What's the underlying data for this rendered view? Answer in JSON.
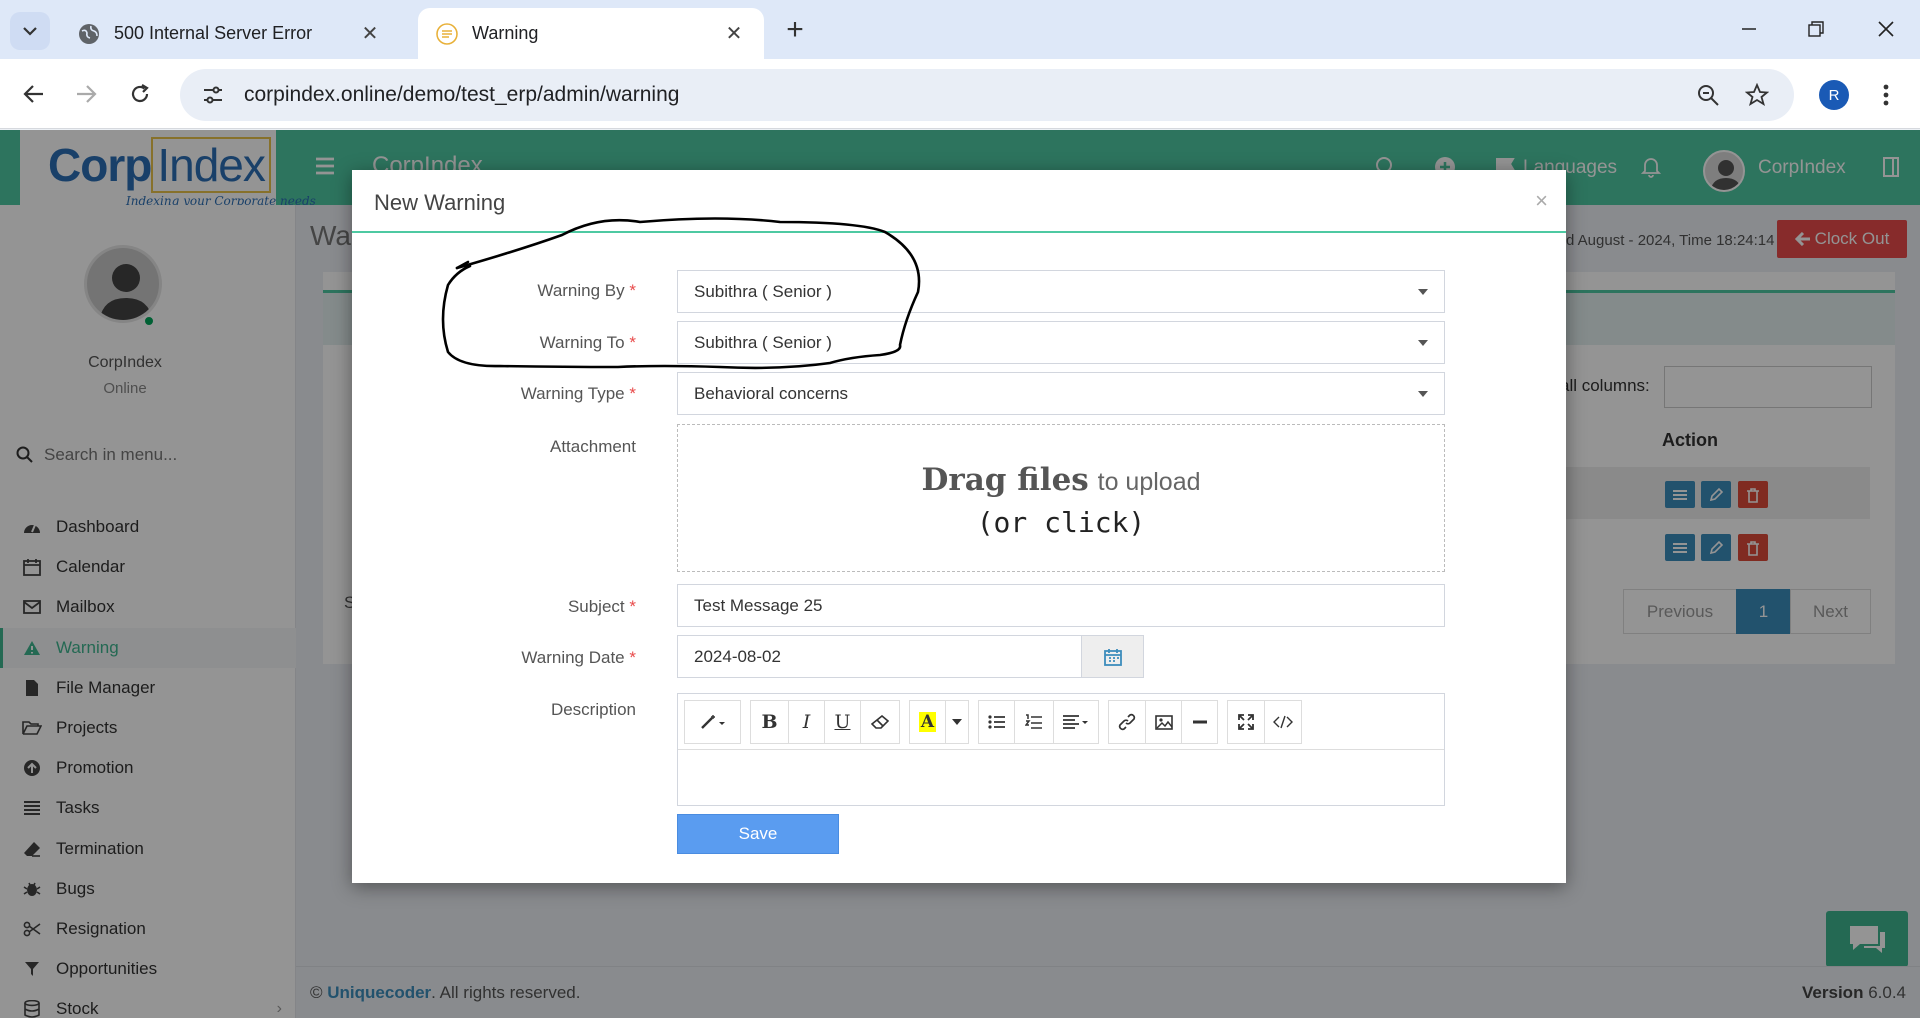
{
  "browser": {
    "tabs": [
      {
        "title": "500 Internal Server Error"
      },
      {
        "title": "Warning"
      }
    ],
    "url": "corpindex.online/demo/test_erp/admin/warning",
    "profile_initial": "R"
  },
  "header": {
    "brand": "CorpIndex",
    "languages": "Languages",
    "user": "CorpIndex",
    "logo": {
      "part1": "Corp",
      "part2": "Index",
      "tagline": "Indexing your Corporate needs"
    }
  },
  "sidebar": {
    "user_name": "CorpIndex",
    "status": "Online",
    "search_placeholder": "Search in menu...",
    "items": [
      {
        "label": "Dashboard",
        "icon": "dashboard-icon"
      },
      {
        "label": "Calendar",
        "icon": "calendar-icon"
      },
      {
        "label": "Mailbox",
        "icon": "envelope-icon"
      },
      {
        "label": "Warning",
        "icon": "warning-icon",
        "active": true
      },
      {
        "label": "File Manager",
        "icon": "file-icon"
      },
      {
        "label": "Projects",
        "icon": "folder-open-icon"
      },
      {
        "label": "Promotion",
        "icon": "arrow-circle-up-icon"
      },
      {
        "label": "Tasks",
        "icon": "tasks-icon"
      },
      {
        "label": "Termination",
        "icon": "eraser-icon"
      },
      {
        "label": "Bugs",
        "icon": "bug-icon"
      },
      {
        "label": "Resignation",
        "icon": "scissors-icon"
      },
      {
        "label": "Opportunities",
        "icon": "filter-icon"
      },
      {
        "label": "Stock",
        "icon": "database-icon"
      }
    ]
  },
  "main": {
    "page_title": "Wa",
    "date_text": "d August - 2024,  Time  18:24:14",
    "clock_out": "Clock Out",
    "search_label": "all columns:",
    "action_header": "Action",
    "left_char": "S",
    "pagination": {
      "previous": "Previous",
      "current": "1",
      "next": "Next"
    }
  },
  "modal": {
    "title": "New Warning",
    "close": "×",
    "fields": {
      "warning_by": {
        "label": "Warning By",
        "value": "Subithra ( Senior )"
      },
      "warning_to": {
        "label": "Warning To",
        "value": "Subithra ( Senior )"
      },
      "warning_type": {
        "label": "Warning Type",
        "value": "Behavioral concerns"
      },
      "attachment": {
        "label": "Attachment",
        "drag_big": "Drag files",
        "drag_small": "to upload",
        "or_click": "(or click)"
      },
      "subject": {
        "label": "Subject",
        "value": "Test Message 25"
      },
      "warning_date": {
        "label": "Warning Date",
        "value": "2024-08-02"
      },
      "description": {
        "label": "Description"
      }
    },
    "required_mark": "*",
    "save": "Save"
  },
  "footer": {
    "copyright_symbol": "©",
    "company": "Uniquecoder",
    "rights": ". All rights reserved.",
    "version_label": "Version",
    "version": "6.0.4"
  },
  "colors": {
    "accent": "#4ec9a2",
    "danger": "#e84a4a",
    "primary": "#5a9cf0"
  }
}
